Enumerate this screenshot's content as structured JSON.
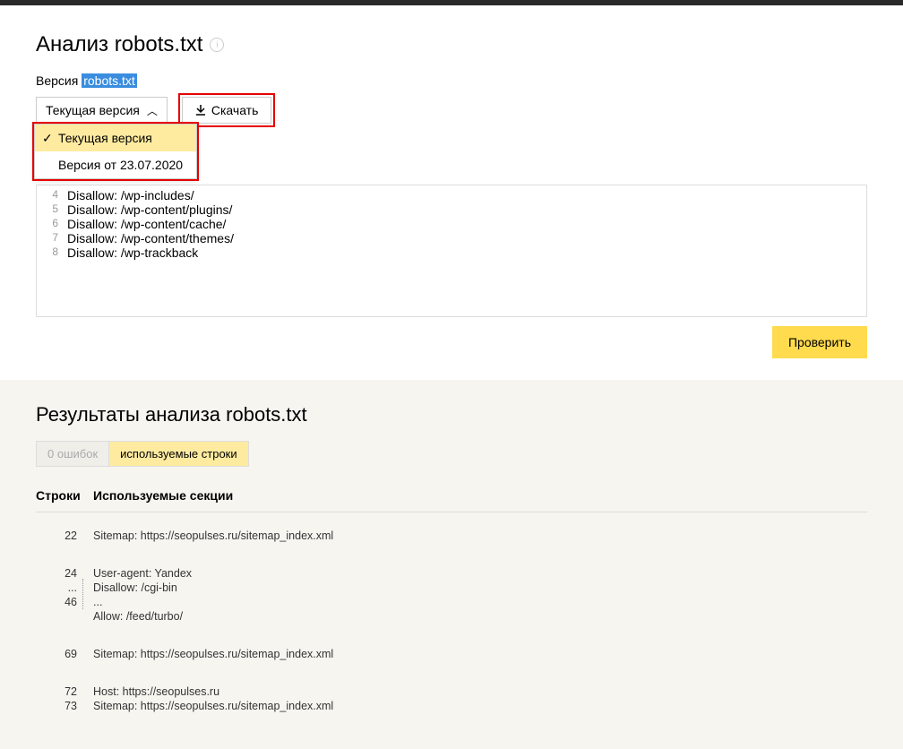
{
  "page": {
    "title": "Анализ robots.txt"
  },
  "version": {
    "label_prefix": "Версия ",
    "highlighted": "robots.txt",
    "selector_text": "Текущая версия",
    "dropdown": [
      {
        "label": "Текущая версия",
        "selected": true
      },
      {
        "label": "Версия от 23.07.2020",
        "selected": false
      }
    ]
  },
  "download": {
    "label": "Скачать"
  },
  "editor": {
    "lines": [
      {
        "n": "4",
        "t": "Disallow: /wp-includes/"
      },
      {
        "n": "5",
        "t": "Disallow: /wp-content/plugins/"
      },
      {
        "n": "6",
        "t": "Disallow: /wp-content/cache/"
      },
      {
        "n": "7",
        "t": "Disallow: /wp-content/themes/"
      },
      {
        "n": "8",
        "t": "Disallow: /wp-trackback"
      }
    ]
  },
  "check_button": "Проверить",
  "results": {
    "title": "Результаты анализа robots.txt",
    "tabs": {
      "errors": "0 ошибок",
      "used": "используемые строки"
    },
    "columns": {
      "lines": "Строки",
      "sections": "Используемые секции"
    },
    "groups": [
      {
        "lines": [
          "22"
        ],
        "content": [
          "Sitemap: https://seopulses.ru/sitemap_index.xml"
        ]
      },
      {
        "lines": [
          "24",
          "",
          "...",
          "46"
        ],
        "content": [
          "User-agent: Yandex",
          "Disallow: /cgi-bin",
          "...",
          "Allow: /feed/turbo/"
        ],
        "dotted": true
      },
      {
        "lines": [
          "69"
        ],
        "content": [
          "Sitemap: https://seopulses.ru/sitemap_index.xml"
        ]
      },
      {
        "lines": [
          "72",
          "73"
        ],
        "content": [
          "Host: https://seopulses.ru",
          "Sitemap: https://seopulses.ru/sitemap_index.xml"
        ]
      }
    ]
  }
}
